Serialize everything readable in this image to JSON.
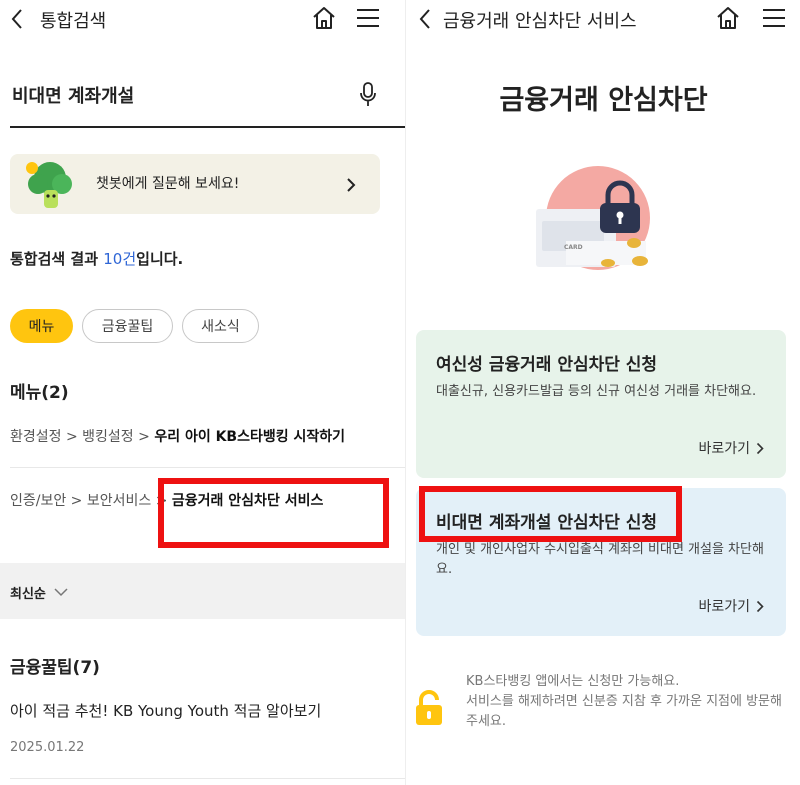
{
  "left": {
    "header": {
      "title": "통합검색"
    },
    "search": {
      "value": "비대면 계좌개설"
    },
    "chatbot": {
      "text": "챗봇에게 질문해 보세요!"
    },
    "result": {
      "prefix": "통합검색 결과 ",
      "count": "10건",
      "suffix": "입니다."
    },
    "chips": [
      "메뉴",
      "금융꿀팁",
      "새소식"
    ],
    "menu_section": {
      "title": "메뉴(2)",
      "items": [
        {
          "path": "환경설정 > 뱅킹설정 > ",
          "target": "우리 아이 KB스타뱅킹 시작하기"
        },
        {
          "path": "인증/보안 > 보안서비스 > ",
          "target": "금융거래 안심차단 서비스"
        }
      ]
    },
    "sort": {
      "label": "최신순"
    },
    "tips_section": {
      "title": "금융꿀팁(7)",
      "items": [
        {
          "title": "아이 적금 추천! KB Young Youth 적금 알아보기",
          "date": "2025.01.22"
        }
      ]
    }
  },
  "right": {
    "header": {
      "title": "금융거래 안심차단 서비스"
    },
    "title": "금융거래 안심차단",
    "illustration": {
      "card_label": "CARD"
    },
    "cards": [
      {
        "title": "여신성 금융거래 안심차단 신청",
        "desc": "대출신규, 신용카드발급 등의 신규 여신성 거래를 차단해요.",
        "link": "바로가기"
      },
      {
        "title": "비대면 계좌개설 안심차단 신청",
        "desc": "개인 및 개인사업자 수시입출식 계좌의 비대면 개설을 차단해요.",
        "link": "바로가기"
      }
    ],
    "notice": [
      "KB스타뱅킹 앱에서는 신청만 가능해요.",
      "서비스를 해제하려면 신분증 지참 후 가까운 지점에 방문해주세요."
    ]
  },
  "colors": {
    "accent": "#ffc50f",
    "highlight": "#ee1111",
    "link_blue": "#2f66d6",
    "green_card": "#e7f3ea",
    "blue_card": "#e3f0f8"
  },
  "icons": [
    "back-arrow-icon",
    "home-icon",
    "hamburger-menu-icon",
    "microphone-icon",
    "chevron-right-icon",
    "chevron-down-icon",
    "lock-icon",
    "chatbot-character-icon"
  ]
}
